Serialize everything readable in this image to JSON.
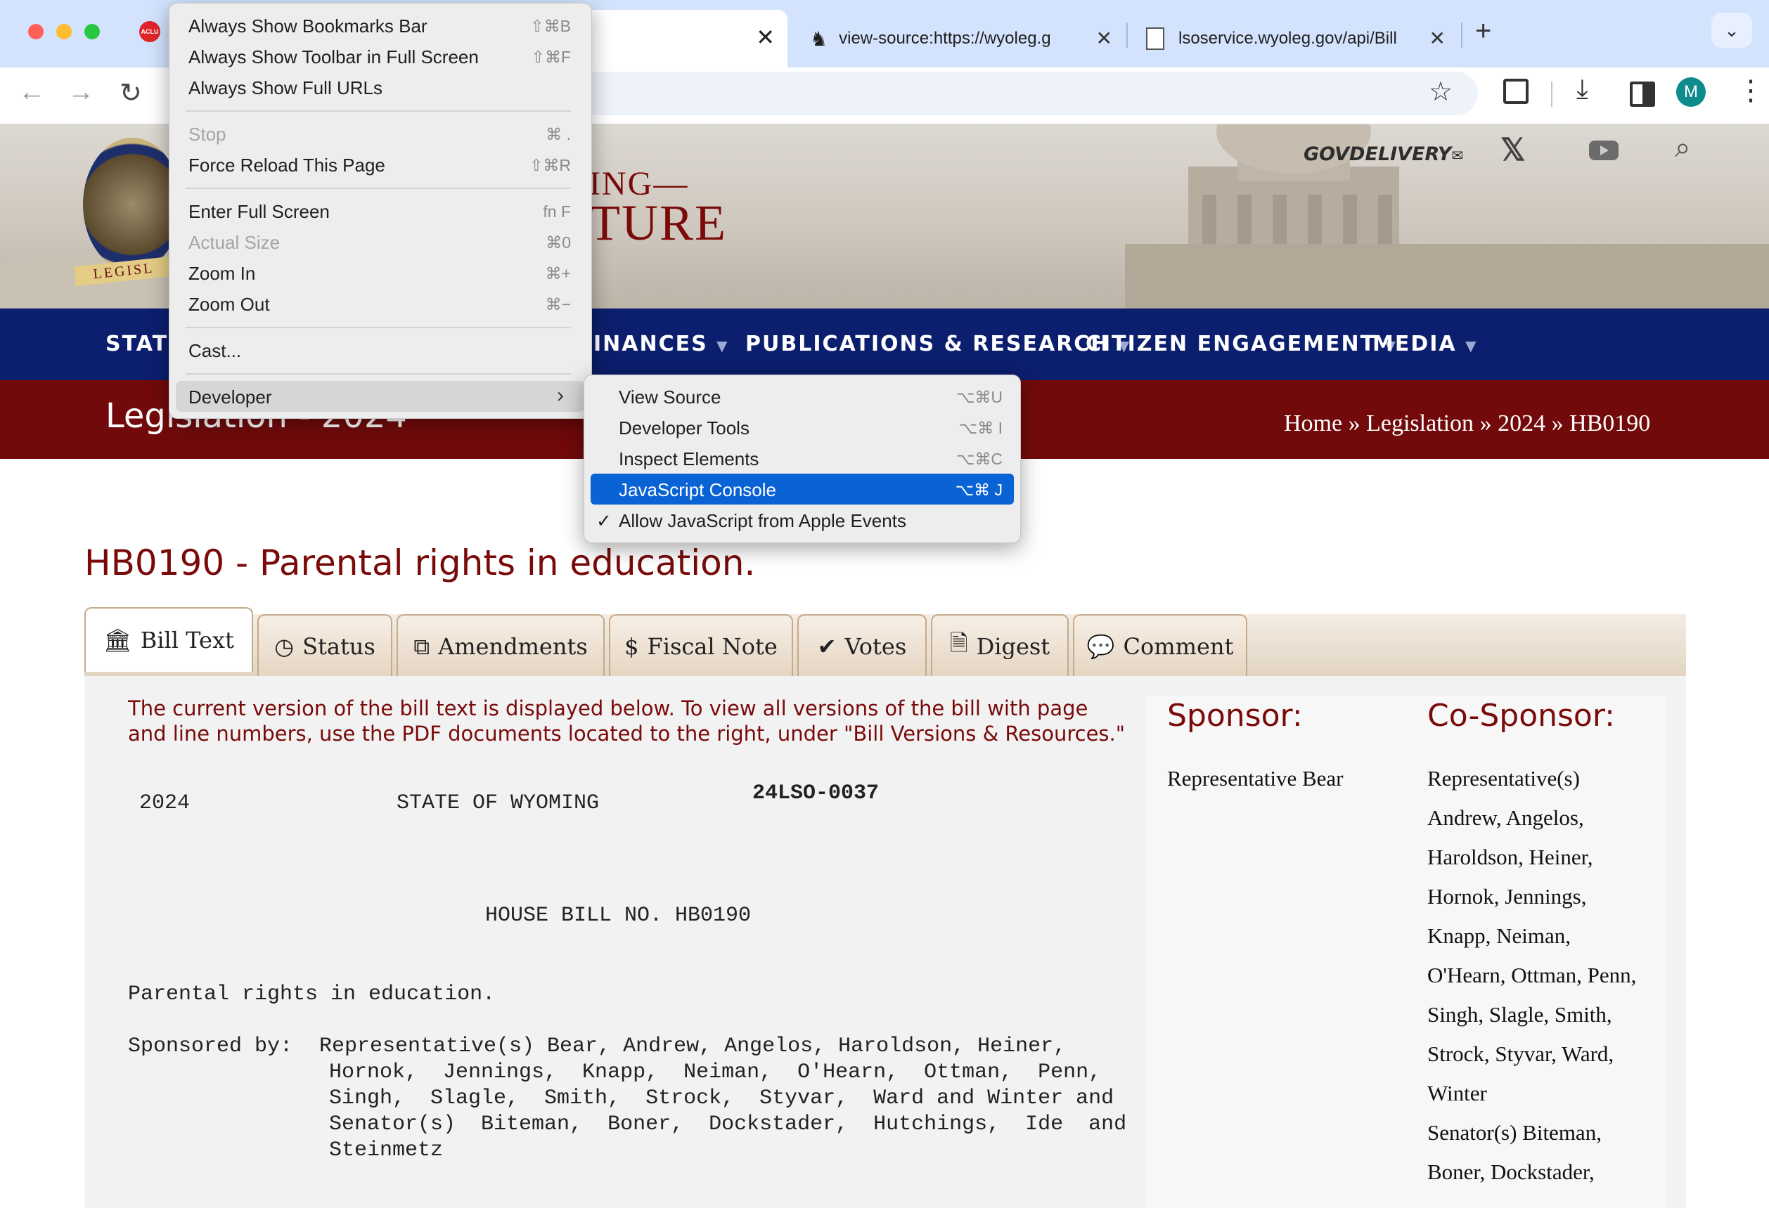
{
  "browser": {
    "tabs": [
      {
        "label": "view-source:https://wyoleg.g",
        "icon": "cowboy-favicon"
      },
      {
        "label": "lsoservice.wyoleg.gov/api/Bill",
        "icon": "document-favicon"
      }
    ],
    "new_tab_label": "+",
    "profile_initial": "M",
    "pinned_favicon_label": "ACLU"
  },
  "view_menu": {
    "items": [
      {
        "label": "Always Show Bookmarks Bar",
        "shortcut": "⇧⌘B",
        "disabled": false
      },
      {
        "label": "Always Show Toolbar in Full Screen",
        "shortcut": "⇧⌘F",
        "disabled": false
      },
      {
        "label": "Always Show Full URLs",
        "shortcut": "",
        "disabled": false
      },
      {
        "label": "Stop",
        "shortcut": "⌘ .",
        "disabled": true
      },
      {
        "label": "Force Reload This Page",
        "shortcut": "⇧⌘R",
        "disabled": false
      },
      {
        "label": "Enter Full Screen",
        "shortcut": "fn F",
        "disabled": false
      },
      {
        "label": "Actual Size",
        "shortcut": "⌘0",
        "disabled": true
      },
      {
        "label": "Zoom In",
        "shortcut": "⌘+",
        "disabled": false
      },
      {
        "label": "Zoom Out",
        "shortcut": "⌘−",
        "disabled": false
      },
      {
        "label": "Cast...",
        "shortcut": "",
        "disabled": false
      },
      {
        "label": "Developer",
        "shortcut": "",
        "disabled": false
      }
    ]
  },
  "developer_menu": {
    "items": [
      {
        "label": "View Source",
        "shortcut": "⌥⌘U"
      },
      {
        "label": "Developer Tools",
        "shortcut": "⌥⌘ I"
      },
      {
        "label": "Inspect Elements",
        "shortcut": "⌥⌘C"
      },
      {
        "label": "JavaScript Console",
        "shortcut": "⌥⌘ J",
        "highlighted": true
      },
      {
        "label": "Allow JavaScript from Apple Events",
        "shortcut": "",
        "checked": true,
        "check_mark": "✓"
      }
    ]
  },
  "site": {
    "logo_text_partial_1": "ING—",
    "logo_text_partial_2": "TURE",
    "seal_text": "LEGISL",
    "govdelivery": "GOVDELIVERY",
    "nav": [
      "STATE",
      "INANCES",
      "PUBLICATIONS & RESEARCH",
      "CITIZEN ENGAGEMENT",
      "MEDIA"
    ],
    "page_heading": "Legislation - 2024",
    "breadcrumb": {
      "home": "Home",
      "sep": "»",
      "legislation": "Legislation",
      "year": "2024",
      "bill": "HB0190"
    }
  },
  "bill": {
    "title": "HB0190 - Parental rights in education.",
    "tabs": [
      {
        "label": "Bill Text",
        "icon": "bank-icon",
        "active": true
      },
      {
        "label": "Status",
        "icon": "clock-icon"
      },
      {
        "label": "Amendments",
        "icon": "copy-icon"
      },
      {
        "label": "Fiscal Note",
        "icon": "dollar-icon"
      },
      {
        "label": "Votes",
        "icon": "check-icon"
      },
      {
        "label": "Digest",
        "icon": "document-icon"
      },
      {
        "label": "Comment",
        "icon": "speech-bubble-icon"
      }
    ],
    "notice": "The current version of the bill text is displayed below. To view all versions of the bill with page and line numbers, use the PDF documents located to the right, under \"Bill Versions & Resources.\"",
    "year": "2024",
    "state": "STATE OF WYOMING",
    "lso_number": "24LSO-0037",
    "house_bill": "HOUSE BILL NO. HB0190",
    "short_title": "Parental rights in education.",
    "sponsored_by_label": "Sponsored by:",
    "sponsored_lines": [
      "Representative(s) Bear, Andrew, Angelos, Haroldson, Heiner,",
      "Hornok,  Jennings,  Knapp,  Neiman,  O'Hearn,  Ottman,  Penn,",
      "Singh,  Slagle,  Smith,  Strock,  Styvar,  Ward and Winter and",
      "Senator(s)  Biteman,  Boner,  Dockstader,  Hutchings,  Ide  and",
      "Steinmetz"
    ],
    "sponsor_heading": "Sponsor:",
    "sponsor": "Representative Bear",
    "cosponsor_heading": "Co-Sponsor:",
    "cosponsor_lines": [
      "Representative(s)",
      "Andrew, Angelos,",
      "Haroldson, Heiner,",
      "Hornok, Jennings,",
      "Knapp, Neiman,",
      "O'Hearn, Ottman, Penn,",
      "Singh, Slagle, Smith,",
      "Strock, Styvar, Ward,",
      "Winter",
      "Senator(s) Biteman,",
      "Boner, Dockstader,"
    ]
  },
  "colors": {
    "nav_blue": "#0c1e6e",
    "crumb_red": "#720a0b",
    "title_red": "#7a0a0a",
    "menu_highlight": "#0a63d4"
  }
}
